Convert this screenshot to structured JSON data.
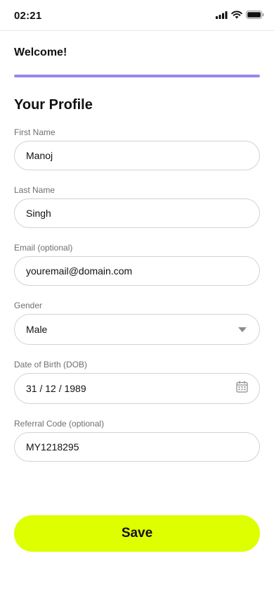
{
  "status_bar": {
    "time": "02:21",
    "icons": [
      "cellular-signal-icon",
      "wifi-icon",
      "battery-icon"
    ]
  },
  "header": {
    "title": "Welcome!",
    "progress": 1.0
  },
  "form": {
    "title": "Your Profile",
    "first_name": {
      "label": "First Name",
      "value": "Manoj"
    },
    "last_name": {
      "label": "Last Name",
      "value": "Singh"
    },
    "email": {
      "label": "Email (optional)",
      "value": "youremail@domain.com"
    },
    "gender": {
      "label": "Gender",
      "value": "Male",
      "icon": "chevron-down-icon"
    },
    "dob": {
      "label": "Date of Birth (DOB)",
      "value": "31 / 12 / 1989",
      "icon": "calendar-icon"
    },
    "referral": {
      "label": "Referral Code (optional)",
      "value": "MY1218295"
    }
  },
  "actions": {
    "save_label": "Save"
  },
  "colors": {
    "accent": "#ddff00",
    "progress": "#9a86ee",
    "border": "#d3d3d3",
    "label": "#6f6f6f"
  }
}
